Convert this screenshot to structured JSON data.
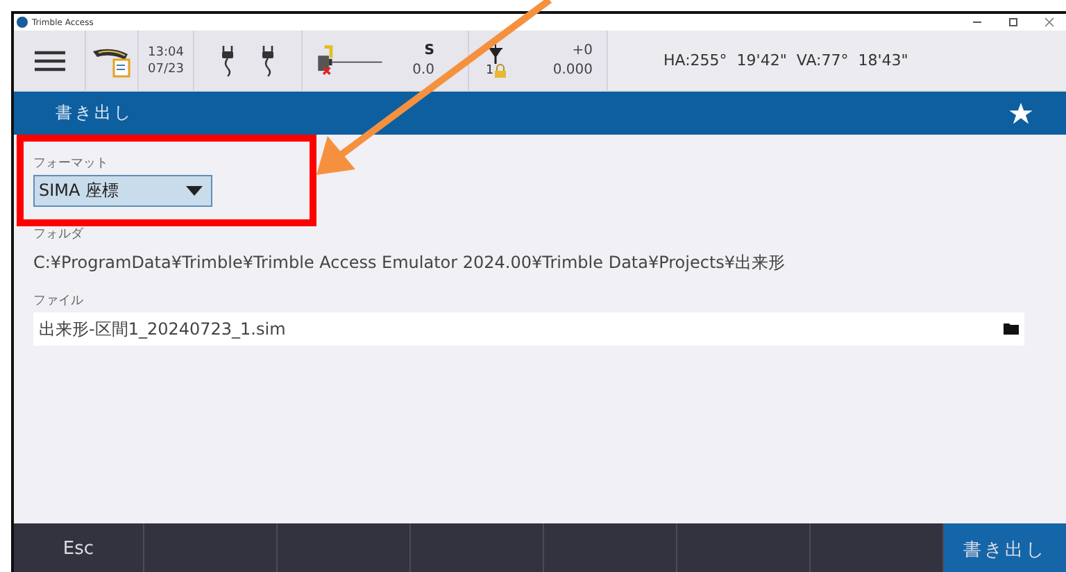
{
  "window": {
    "title": "Trimble Access"
  },
  "status_bar": {
    "time": "13:04",
    "date": "07/23",
    "instrument": {
      "label": "S",
      "value": "0.0"
    },
    "target": {
      "count": "1",
      "offset": "+0",
      "value": "0.000"
    },
    "angles": "HA:255°  19'42\"  VA:77°  18'43\""
  },
  "header": {
    "title": "書き出し"
  },
  "fields": [
    {
      "kind": "dropdown",
      "label": "フォーマット",
      "value": "SIMA 座標"
    },
    {
      "kind": "text",
      "label": "フォルダ",
      "value": "C:¥ProgramData¥Trimble¥Trimble Access Emulator 2024.00¥Trimble Data¥Projects¥出来形"
    },
    {
      "kind": "file",
      "label": "ファイル",
      "value": "出来形-区間1_20240723_1.sim"
    }
  ],
  "softkeys": [
    {
      "kind": "normal",
      "label": "Esc"
    },
    {
      "kind": "empty"
    },
    {
      "kind": "empty"
    },
    {
      "kind": "empty"
    },
    {
      "kind": "empty"
    },
    {
      "kind": "empty"
    },
    {
      "kind": "empty"
    },
    {
      "kind": "primary",
      "label": "書き出し"
    }
  ],
  "annotations": [
    {
      "kind": "box",
      "color": "#ff0000"
    },
    {
      "kind": "arrow",
      "color": "#f5913e"
    }
  ]
}
